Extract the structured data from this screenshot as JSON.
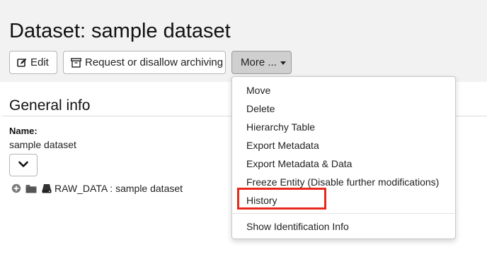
{
  "page": {
    "title": "Dataset: sample dataset"
  },
  "toolbar": {
    "edit_label": "Edit",
    "archive_label": "Request or disallow archiving",
    "more_label": "More ..."
  },
  "more_menu": {
    "items": [
      "Move",
      "Delete",
      "Hierarchy Table",
      "Export Metadata",
      "Export Metadata & Data",
      "Freeze Entity (Disable further modifications)",
      "History",
      "Show Identification Info"
    ],
    "highlighted_item": "History"
  },
  "general_info": {
    "section_title": "General info",
    "name_label": "Name:",
    "name_value": "sample dataset"
  },
  "tree": {
    "node_label": "RAW_DATA : sample dataset"
  },
  "icons": {
    "edit": "edit-icon",
    "archive": "archive-box-icon",
    "dropdown": "caret-down-icon",
    "expand": "chevron-down-icon",
    "tree_expand": "plus-circle-icon",
    "folder": "folder-icon",
    "dataset": "dataset-drive-icon"
  },
  "colors": {
    "header_background": "#f2f2f2",
    "active_button": "#cfcfcf",
    "highlight": "#e8281b"
  }
}
